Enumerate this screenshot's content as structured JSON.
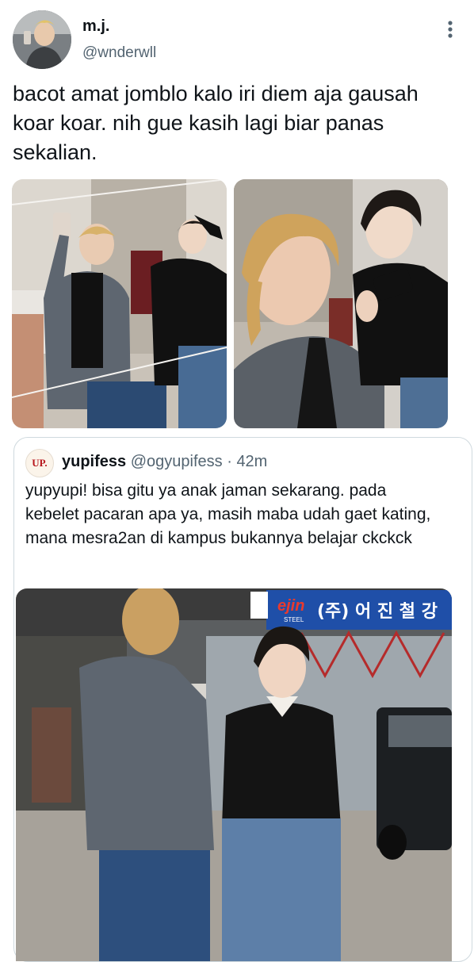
{
  "author": {
    "display_name": "m.j.",
    "handle": "@wnderwll",
    "avatar_icon": "profile-photo"
  },
  "tweet": {
    "text": "bacot amat jomblo kalo iri diem aja gausah\nkoar koar. nih gue kasih lagi biar panas\nsekalian."
  },
  "media": [
    {
      "name": "mirror-selfie-photo"
    },
    {
      "name": "close-up-selfie-photo"
    }
  ],
  "quote": {
    "avatar_text": "UP.",
    "display_name": "yupifess",
    "handle": "@ogyupifess",
    "separator": "·",
    "time": "42m",
    "text": "yupyupi! bisa gitu ya anak jaman sekarang. pada kebelet pacaran apa ya, masih maba udah gaet kating, mana mesra2an di kampus bukannya belajar ckckck",
    "photo": {
      "sign_left": "ejin",
      "sign_left_sub": "STEEL",
      "sign_right": "(주) 어 진 철 강"
    }
  },
  "colors": {
    "text_primary": "#0f1419",
    "text_secondary": "#536471",
    "border": "#cfd9de",
    "sign_blue": "#1f4fa8"
  }
}
